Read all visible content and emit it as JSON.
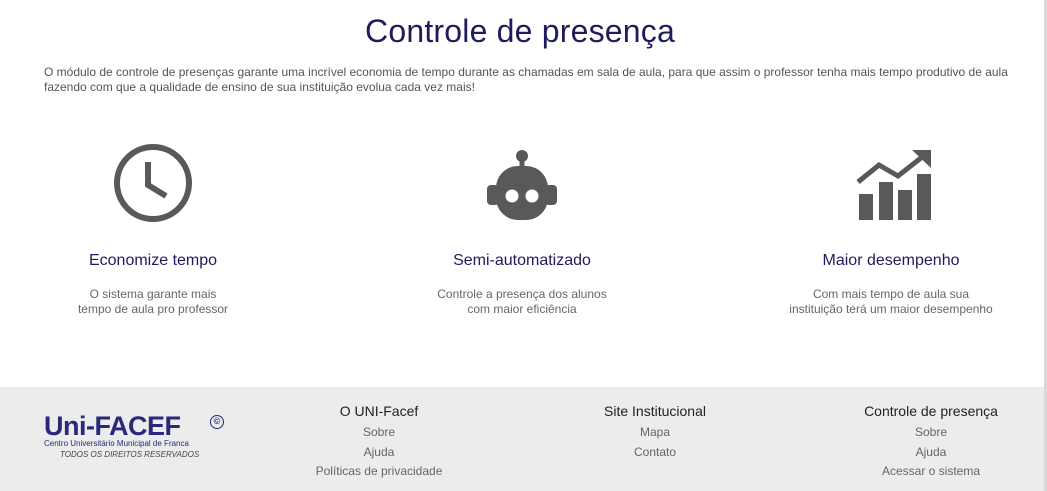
{
  "main": {
    "title": "Controle de presença",
    "intro": "O módulo de controle de presenças garante uma incrível economia de tempo durante as chamadas em sala de aula, para que assim o professor tenha mais tempo produtivo de aula fazendo com que a  qualidade de ensino de sua instituição evolua cada vez mais!",
    "features": [
      {
        "icon": "clock-icon",
        "title": "Economize tempo",
        "desc_line1": "O sistema garante mais",
        "desc_line2": "tempo de aula pro professor"
      },
      {
        "icon": "robot-icon",
        "title": "Semi-automatizado",
        "desc_line1": "Controle a presença dos alunos",
        "desc_line2": "com maior eficiência"
      },
      {
        "icon": "chart-growth-icon",
        "title": "Maior desempenho",
        "desc_line1": "Com mais tempo de aula sua",
        "desc_line2": "instituição terá um maior desempenho"
      }
    ],
    "icon_color": "#595959",
    "title_color": "#1f1c5c"
  },
  "footer": {
    "logo": {
      "word": "Uni-FACEF",
      "mark": "©",
      "subtitle": "Centro Universitário Municipal de Franca",
      "rights": "TODOS OS DIREITOS RESERVADOS"
    },
    "columns": [
      {
        "heading": "O UNI-Facef",
        "links": [
          "Sobre",
          "Ajuda",
          "Políticas de privacidade"
        ]
      },
      {
        "heading": "Site Institucional",
        "links": [
          "Mapa",
          "Contato"
        ]
      },
      {
        "heading": "Controle de presença",
        "links": [
          "Sobre",
          "Ajuda",
          "Acessar o sistema"
        ]
      }
    ],
    "background": "#ececec",
    "brand_color": "#2a287a"
  }
}
